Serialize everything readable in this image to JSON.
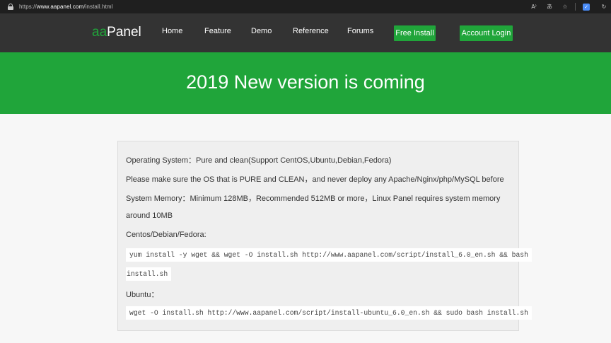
{
  "browser": {
    "url_prefix": "https://",
    "url_domain": "www.aapanel.com",
    "url_path": "/install.html",
    "icons": [
      "read-aloud-icon",
      "translate-icon",
      "favorite-icon",
      "extension-icon",
      "refresh-icon"
    ]
  },
  "header": {
    "logo_prefix": "aa",
    "logo_suffix": "Panel",
    "nav": [
      "Home",
      "Feature",
      "Demo",
      "Reference",
      "Forums"
    ],
    "free_install_label": "Free Install",
    "account_login_label": "Account Login",
    "accent_color": "#20a53a"
  },
  "hero": {
    "title": "2019 New version is coming"
  },
  "content": {
    "os_line": "Operating System：Pure and clean(Support CentOS,Ubuntu,Debian,Fedora)",
    "pure_line": "Please make sure the OS that is PURE and CLEAN，and never deploy any Apache/Nginx/php/MySQL before",
    "memory_line": "System Memory：Minimum 128MB，Recommended 512MB or more，Linux Panel requires system memory",
    "memory_line_2": "around 10MB",
    "centos_label": "Centos/Debian/Fedora:",
    "centos_cmd_1": "yum install -y wget && wget -O install.sh http://www.aapanel.com/script/install_6.0_en.sh && bash",
    "centos_cmd_2": "install.sh",
    "ubuntu_label": "Ubuntu：",
    "ubuntu_cmd": "wget -O install.sh http://www.aapanel.com/script/install-ubuntu_6.0_en.sh && sudo bash install.sh"
  }
}
